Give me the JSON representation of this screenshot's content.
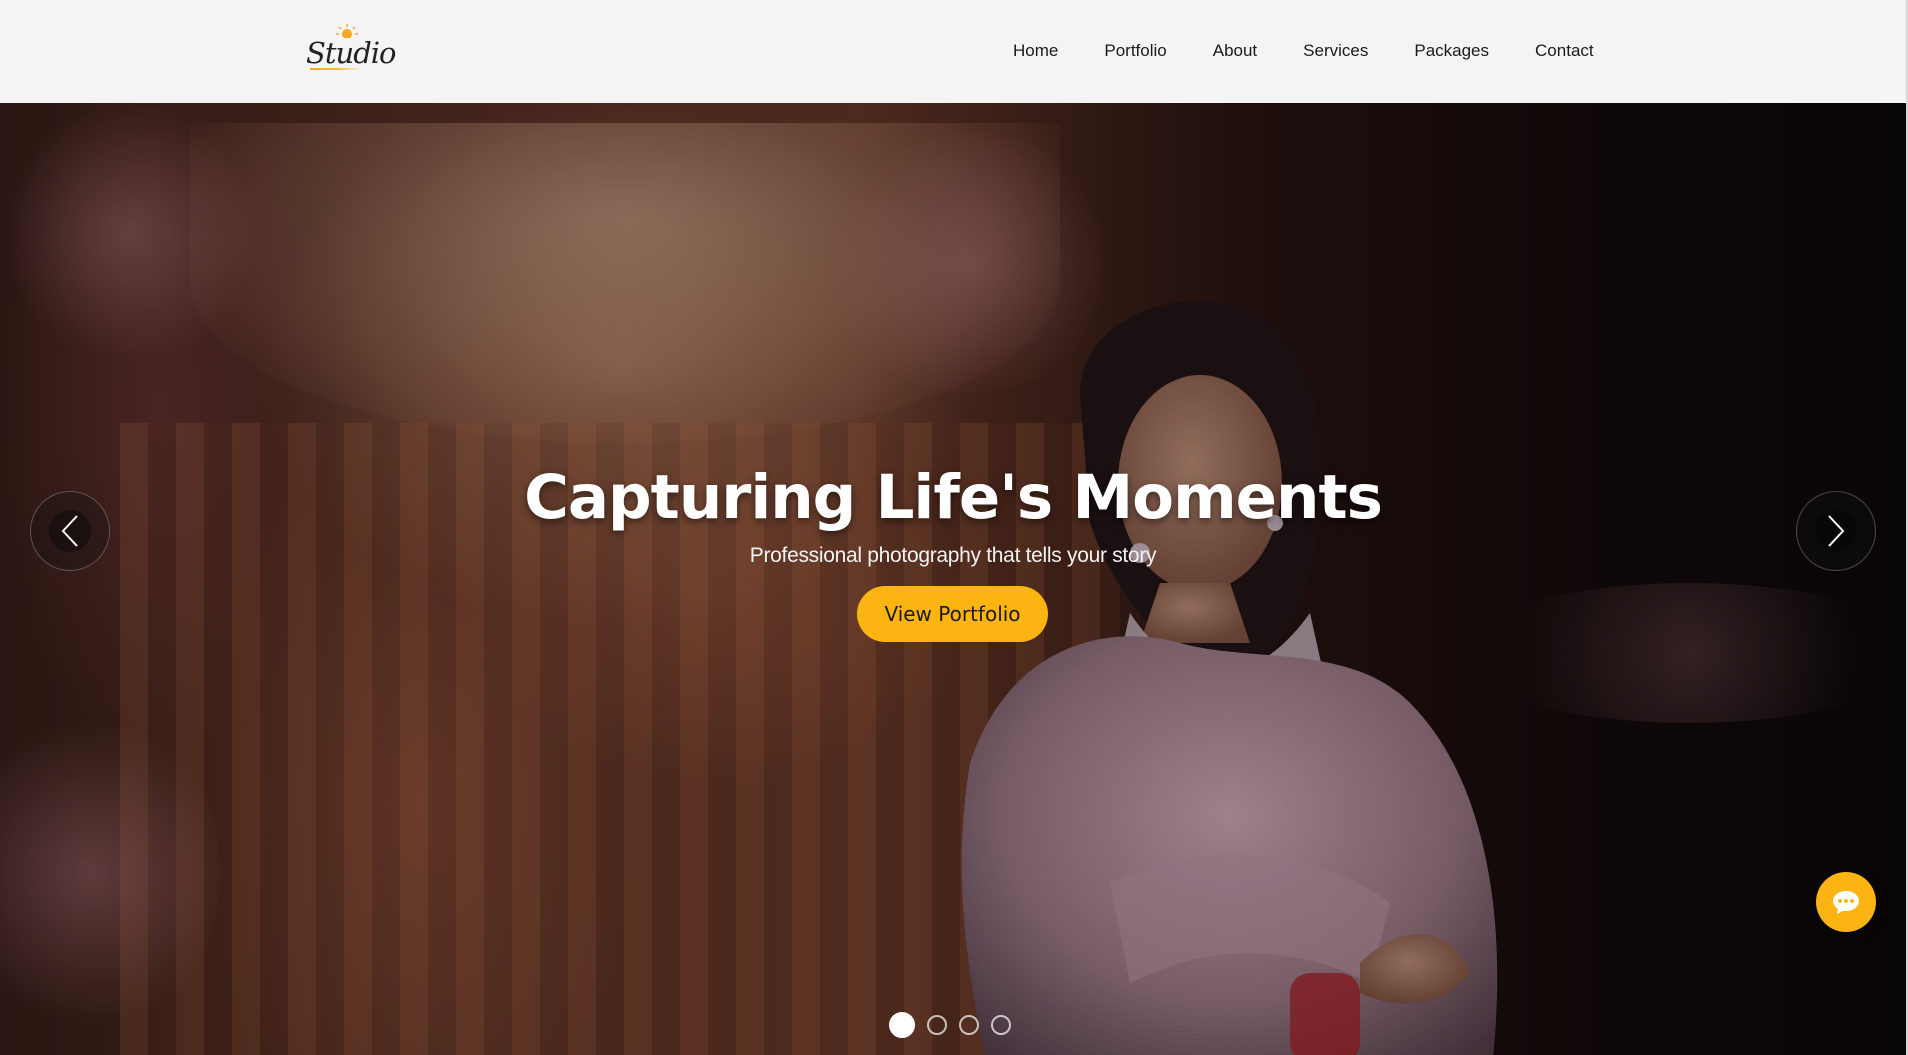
{
  "brand": {
    "logo_text": "Studio"
  },
  "nav": {
    "items": [
      {
        "label": "Home"
      },
      {
        "label": "Portfolio"
      },
      {
        "label": "About"
      },
      {
        "label": "Services"
      },
      {
        "label": "Packages"
      },
      {
        "label": "Contact"
      }
    ]
  },
  "hero": {
    "title": "Capturing Life's Moments",
    "subtitle": "Professional photography that tells your story",
    "cta_label": "View Portfolio",
    "prev_icon": "chevron-left-icon",
    "next_icon": "chevron-right-icon",
    "slides_total": 4,
    "active_slide": 1
  },
  "chat": {
    "icon": "chat-bubble-icon"
  },
  "colors": {
    "accent": "#fbb411",
    "nav_bg": "#f4f4f4",
    "nav_text": "#1a1a1a",
    "hero_text": "#ffffff"
  }
}
